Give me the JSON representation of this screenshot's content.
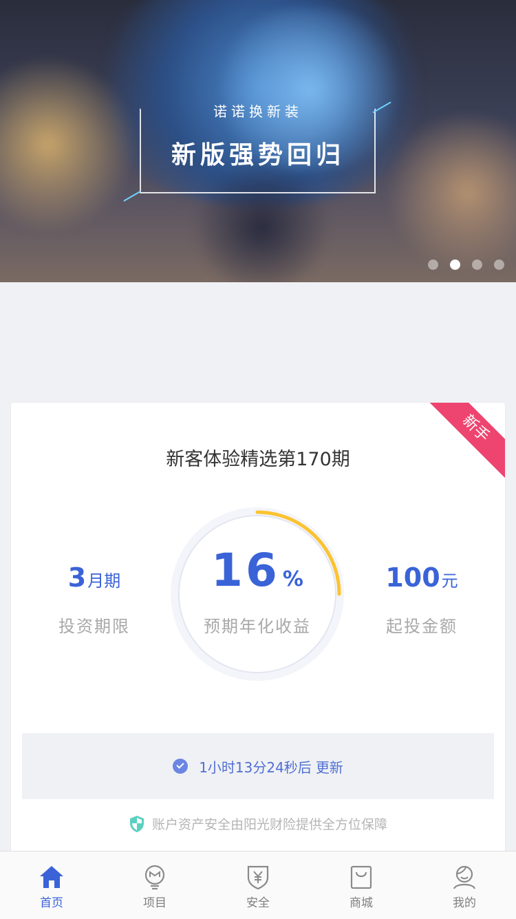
{
  "banner": {
    "subtitle": "诺诺换新装",
    "title": "新版强势回归",
    "slides": 4,
    "active_slide": 2
  },
  "product": {
    "badge": "新手",
    "title": "新客体验精选第170期",
    "rate_value": "16",
    "rate_unit": "%",
    "rate_label": "预期年化收益",
    "term_value": "3",
    "term_unit": "月期",
    "term_label": "投资期限",
    "min_value": "100",
    "min_unit": "元",
    "min_label": "起投金额",
    "progress_fraction": 0.25
  },
  "timer": {
    "countdown": "1小时13分24秒后",
    "action": "更新"
  },
  "safety_note": "账户资产安全由阳光财险提供全方位保障",
  "tabs": [
    {
      "label": "首页",
      "icon": "home-icon",
      "active": true
    },
    {
      "label": "项目",
      "icon": "lightbulb-icon",
      "active": false
    },
    {
      "label": "安全",
      "icon": "shield-yen-icon",
      "active": false
    },
    {
      "label": "商城",
      "icon": "shopping-bag-icon",
      "active": false
    },
    {
      "label": "我的",
      "icon": "user-icon",
      "active": false
    }
  ],
  "colors": {
    "primary": "#3a63d8",
    "ribbon": "#ee4470",
    "gauge_progress": "#fbc330",
    "muted_text": "#a8a8a8"
  }
}
